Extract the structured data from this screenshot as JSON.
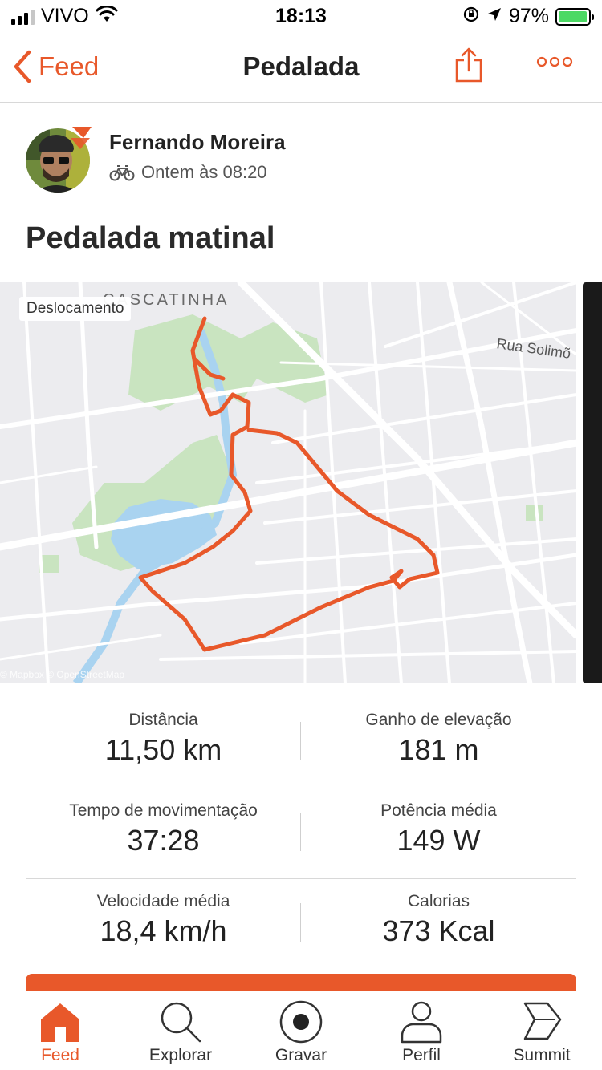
{
  "status_bar": {
    "carrier": "VIVO",
    "time": "18:13",
    "battery_percent": "97%",
    "battery_level": 0.97,
    "icons": [
      "signal-icon",
      "wifi-icon",
      "orientation-lock-icon",
      "location-arrow-icon",
      "battery-charging-icon"
    ]
  },
  "nav": {
    "back_label": "Feed",
    "title": "Pedalada",
    "share_icon": "share-icon",
    "more_icon": "more-options-icon"
  },
  "athlete": {
    "name": "Fernando Moreira",
    "timestamp": "Ontem às 08:20",
    "sport_icon": "bicycle-icon"
  },
  "activity": {
    "title": "Pedalada matinal"
  },
  "map": {
    "badge": "Deslocamento",
    "neighborhood_label": "CASCATINHA",
    "street_label": "Rua Solimõ",
    "attribution": "© Mapbox © OpenStreetMap",
    "route_color": "#e8582a"
  },
  "stats": [
    {
      "left_label": "Distância",
      "left_value": "11,50 km",
      "right_label": "Ganho de elevação",
      "right_value": "181 m"
    },
    {
      "left_label": "Tempo de movimentação",
      "left_value": "37:28",
      "right_label": "Potência média",
      "right_value": "149 W"
    },
    {
      "left_label": "Velocidade média",
      "left_value": "18,4 km/h",
      "right_label": "Calorias",
      "right_value": "373 Kcal"
    }
  ],
  "tabs": [
    {
      "label": "Feed",
      "icon": "home-icon",
      "active": true
    },
    {
      "label": "Explorar",
      "icon": "search-icon",
      "active": false
    },
    {
      "label": "Gravar",
      "icon": "record-icon",
      "active": false
    },
    {
      "label": "Perfil",
      "icon": "profile-icon",
      "active": false
    },
    {
      "label": "Summit",
      "icon": "summit-icon",
      "active": false
    }
  ],
  "colors": {
    "accent": "#e8582a",
    "map_park": "#c9e4c0",
    "map_water": "#a9d3f0"
  }
}
